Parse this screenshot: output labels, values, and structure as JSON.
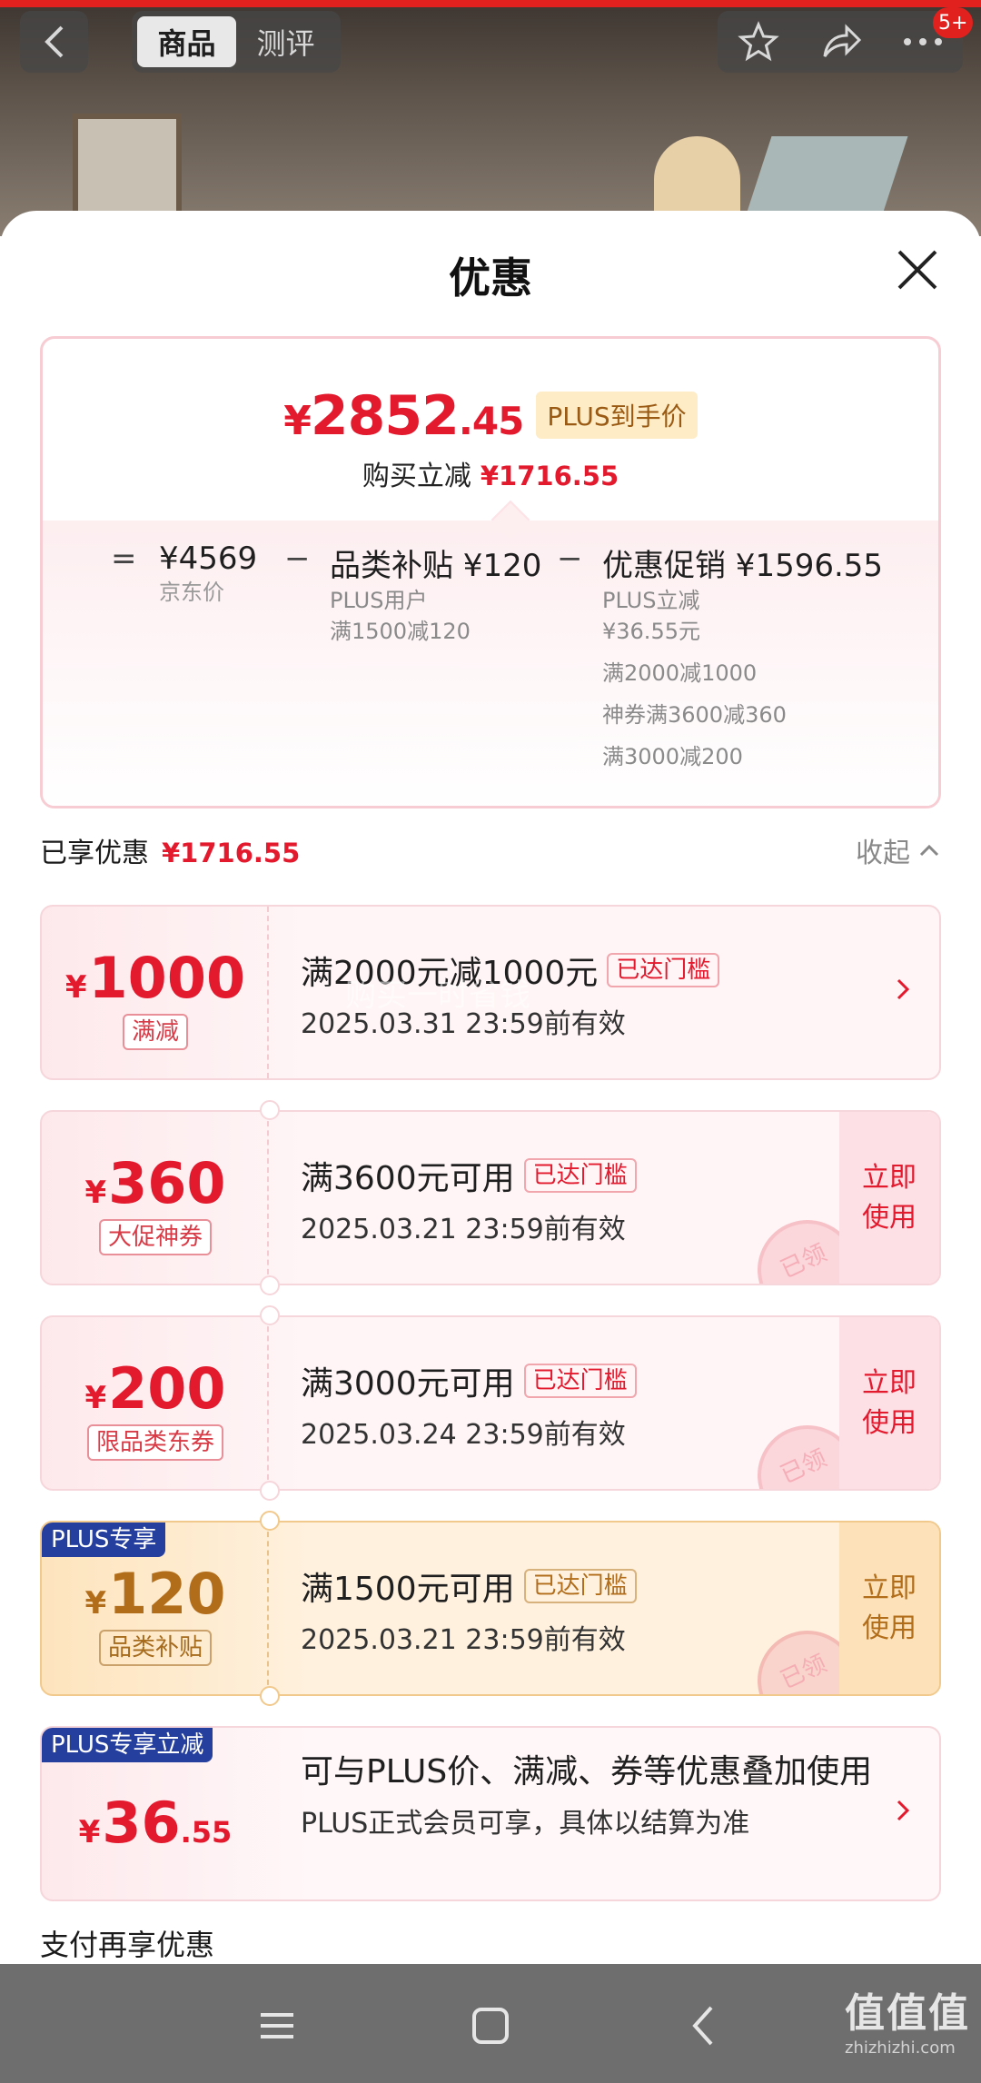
{
  "header": {
    "tabs": [
      "商品",
      "测评"
    ],
    "cart_count": "5+"
  },
  "sheet": {
    "title": "优惠"
  },
  "summary": {
    "price_yen": "¥",
    "price_int": "2852",
    "price_dec": ".45",
    "price_tag": "PLUS到手价",
    "reduce_label": "购买立减",
    "reduce_amount": "¥1716.55",
    "equals": "=",
    "minus": "−",
    "base_price": "¥4569",
    "base_label": "京东价",
    "subsidy_title": "品类补贴 ¥120",
    "subsidy_lines": [
      "PLUS用户",
      "满1500减120"
    ],
    "promo_title": "优惠促销 ¥1596.55",
    "promo_lines": [
      "PLUS立减",
      "¥36.55元",
      "满2000减1000",
      "神券满3600减360",
      "满3000减200"
    ]
  },
  "enjoyed": {
    "label": "已享优惠",
    "amount": "¥1716.55",
    "collapse": "收起"
  },
  "coupons": [
    {
      "yen": "¥",
      "amount": "1000",
      "tag": "满减",
      "title": "满2000元减1000元",
      "reach": "已达门槛",
      "date": "2025.03.31 23:59前有效"
    },
    {
      "yen": "¥",
      "amount": "360",
      "tag": "大促神券",
      "title": "满3600元可用",
      "reach": "已达门槛",
      "date": "2025.03.21 23:59前有效",
      "use": "立即\n使用",
      "stamp": "已领"
    },
    {
      "yen": "¥",
      "amount": "200",
      "tag": "限品类东券",
      "title": "满3000元可用",
      "reach": "已达门槛",
      "date": "2025.03.24 23:59前有效",
      "use": "立即\n使用",
      "stamp": "已领"
    },
    {
      "plus_label": "PLUS专享",
      "yen": "¥",
      "amount": "120",
      "tag": "品类补贴",
      "title": "满1500元可用",
      "reach": "已达门槛",
      "date": "2025.03.21 23:59前有效",
      "use": "立即\n使用",
      "stamp": "已领"
    },
    {
      "plus_label": "PLUS专享立减",
      "yen": "¥",
      "amount": "36",
      "amount_dec": ".55",
      "desc_line1": "可与PLUS价、满减、券等优惠叠加使用",
      "desc_line2": "PLUS正式会员可享，具体以结算为准"
    }
  ],
  "watermark": "购买一时省钱",
  "pay_title": "支付再享优惠",
  "brand": {
    "name": "值值值",
    "url": "zhizhizhi.com"
  },
  "colors": {
    "accent_red": "#e3192e",
    "plus_blue": "#253f9f",
    "gold": "#b26d1a"
  }
}
